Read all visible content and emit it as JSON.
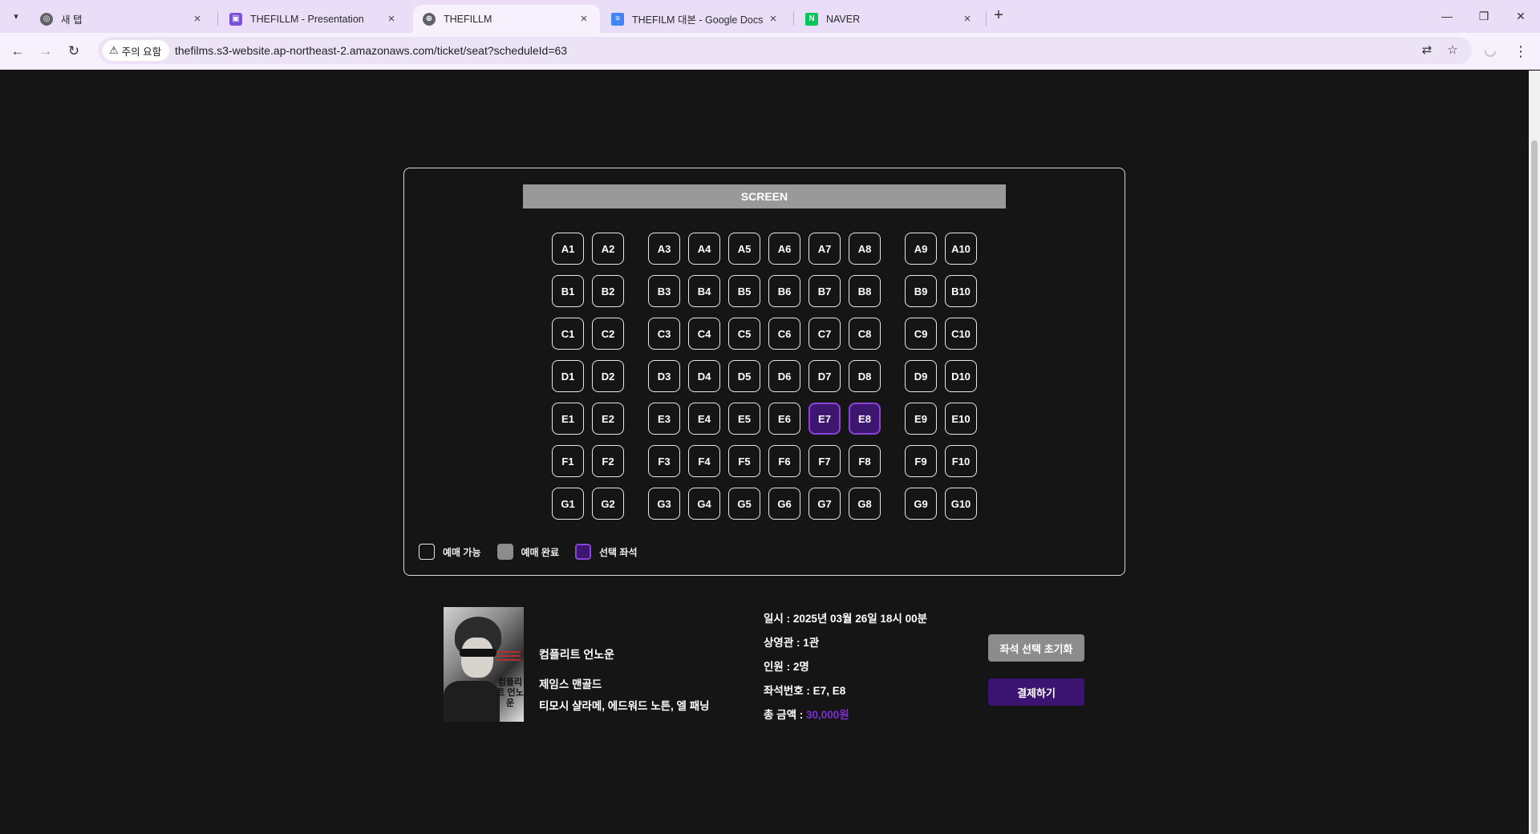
{
  "browser": {
    "tabs": [
      {
        "title": "새 탭",
        "icon": "chrome-icon",
        "active": false
      },
      {
        "title": "THEFILLM - Presentation",
        "icon": "presentation-icon",
        "active": false
      },
      {
        "title": "THEFILLM",
        "icon": "globe-icon",
        "active": true
      },
      {
        "title": "THEFILM 대본 - Google Docs",
        "icon": "docs-icon",
        "active": false
      },
      {
        "title": "NAVER",
        "icon": "naver-icon",
        "active": false
      }
    ],
    "security_label": "주의 요함",
    "url": "thefilms.s3-website.ap-northeast-2.amazonaws.com/ticket/seat?scheduleId=63"
  },
  "screen_label": "SCREEN",
  "seat_rows": [
    [
      "A1",
      "A2",
      "A3",
      "A4",
      "A5",
      "A6",
      "A7",
      "A8",
      "A9",
      "A10"
    ],
    [
      "B1",
      "B2",
      "B3",
      "B4",
      "B5",
      "B6",
      "B7",
      "B8",
      "B9",
      "B10"
    ],
    [
      "C1",
      "C2",
      "C3",
      "C4",
      "C5",
      "C6",
      "C7",
      "C8",
      "C9",
      "C10"
    ],
    [
      "D1",
      "D2",
      "D3",
      "D4",
      "D5",
      "D6",
      "D7",
      "D8",
      "D9",
      "D10"
    ],
    [
      "E1",
      "E2",
      "E3",
      "E4",
      "E5",
      "E6",
      "E7",
      "E8",
      "E9",
      "E10"
    ],
    [
      "F1",
      "F2",
      "F3",
      "F4",
      "F5",
      "F6",
      "F7",
      "F8",
      "F9",
      "F10"
    ],
    [
      "G1",
      "G2",
      "G3",
      "G4",
      "G5",
      "G6",
      "G7",
      "G8",
      "G9",
      "G10"
    ]
  ],
  "selected_seats": [
    "E7",
    "E8"
  ],
  "booked_seats": [],
  "legend": {
    "available": "예매 가능",
    "booked": "예매 완료",
    "selected": "선택 좌석"
  },
  "poster": {
    "title_text": "컴플리트 언노운"
  },
  "movie": {
    "title": "컴플리트 언노운",
    "director": "제임스 맨골드",
    "cast": "티모시 샬라메, 에드워드 노튼, 엘 패닝"
  },
  "booking": {
    "datetime": "일시 : 2025년 03월 26일 18시 00분",
    "hall": "상영관 : 1관",
    "people": "인원 : 2명",
    "seats": "좌석번호 : E7, E8",
    "total_label": "총 금액 : ",
    "total_price": "30,000원"
  },
  "buttons": {
    "reset": "좌석 선택 초기화",
    "pay": "결제하기"
  },
  "colors": {
    "page_bg": "#151515",
    "selected_seat_bg": "#3d1670",
    "selected_seat_border": "#8a44d9",
    "pay_button": "#3a1470",
    "price_accent": "#7a2fd0",
    "tabbar_bg": "#e9ddf7"
  }
}
